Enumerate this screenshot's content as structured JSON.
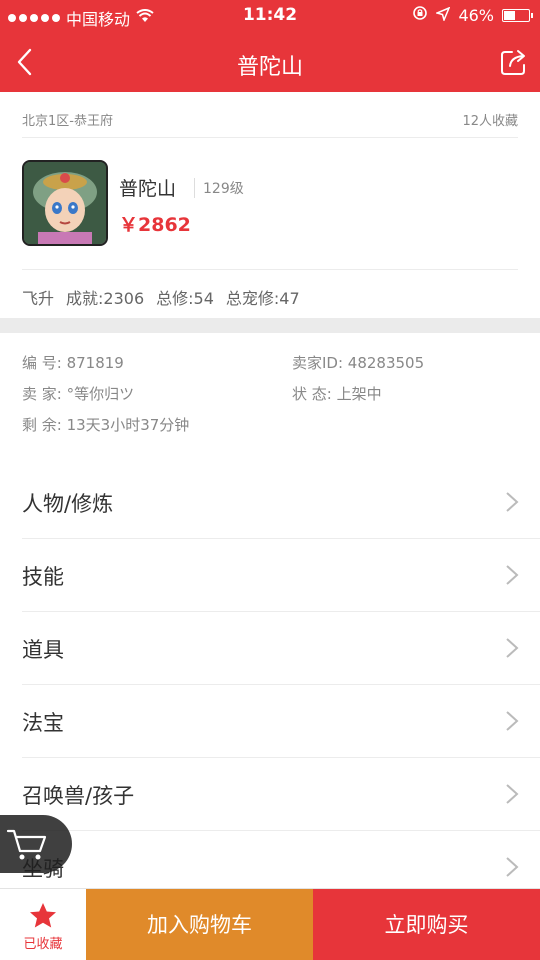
{
  "status_bar": {
    "carrier": "中国移动",
    "time": "11:42",
    "battery": "46%",
    "battery_level": 0.46,
    "signal_dots": 5
  },
  "nav": {
    "title": "普陀山",
    "back_icon": "chevron-left-icon",
    "share_icon": "share-icon"
  },
  "listing": {
    "server": "北京1区-恭王府",
    "favorites": "12人收藏"
  },
  "role": {
    "name": "普陀山",
    "level": "129级",
    "price": "￥2862"
  },
  "stats": [
    "飞升",
    "成就:2306",
    "总修:54",
    "总宠修:47"
  ],
  "details": {
    "number": "编  号: 871819",
    "seller_id": "卖家ID: 48283505",
    "seller": "卖  家: °等你归ツ",
    "status": "状  态: 上架中",
    "remaining": "剩  余: 13天3小时37分钟"
  },
  "menu": [
    {
      "label": "人物/修炼"
    },
    {
      "label": "技能"
    },
    {
      "label": "道具"
    },
    {
      "label": "法宝"
    },
    {
      "label": "召唤兽/孩子"
    },
    {
      "label": "坐骑"
    }
  ],
  "bottom": {
    "favorited_label": "已收藏",
    "add_to_cart": "加入购物车",
    "buy_now": "立即购买"
  },
  "colors": {
    "brand_red": "#e7353a",
    "cart_orange": "#e08a2a"
  }
}
